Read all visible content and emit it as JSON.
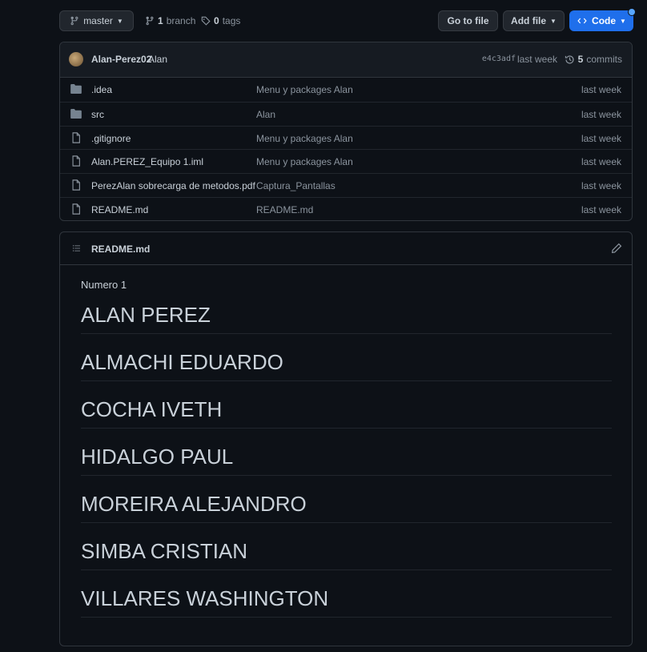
{
  "toolbar": {
    "branch_name": "master",
    "branches_count": "1",
    "branches_label": "branch",
    "tags_count": "0",
    "tags_label": "tags",
    "go_to_file": "Go to file",
    "add_file": "Add file",
    "code": "Code"
  },
  "commit": {
    "author": "Alan-Perez02",
    "message": "Alan",
    "sha": "e4c3adf",
    "time": "last week",
    "commits_count": "5",
    "commits_label": "commits"
  },
  "files": [
    {
      "type": "folder",
      "name": ".idea",
      "message": "Menu y packages Alan",
      "time": "last week"
    },
    {
      "type": "folder",
      "name": "src",
      "message": "Alan",
      "time": "last week"
    },
    {
      "type": "file",
      "name": ".gitignore",
      "message": "Menu y packages Alan",
      "time": "last week"
    },
    {
      "type": "file",
      "name": "Alan.PEREZ_Equipo 1.iml",
      "message": "Menu y packages Alan",
      "time": "last week"
    },
    {
      "type": "file",
      "name": "PerezAlan sobrecarga de metodos.pdf",
      "message": "Captura_Pantallas",
      "time": "last week"
    },
    {
      "type": "file",
      "name": "README.md",
      "message": "README.md",
      "time": "last week"
    }
  ],
  "readme": {
    "title": "README.md",
    "intro": "Numero 1",
    "headings": [
      "ALAN PEREZ",
      "ALMACHI EDUARDO",
      "COCHA IVETH",
      "HIDALGO PAUL",
      "MOREIRA ALEJANDRO",
      "SIMBA CRISTIAN",
      "VILLARES WASHINGTON"
    ]
  },
  "colors": {
    "background": "#0d1117",
    "code_button": "#1f6feb",
    "folder_icon": "#768390"
  }
}
